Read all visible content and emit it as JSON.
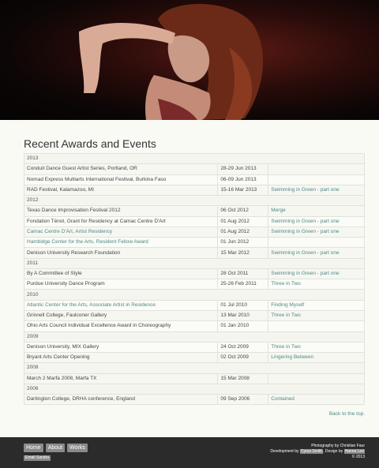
{
  "section_title": "Recent Awards and Events",
  "rows": [
    {
      "type": "year",
      "label": "2013"
    },
    {
      "type": "event",
      "title": "Conduit Dance Guest Artist Series, Portland, OR",
      "title_link": false,
      "date": "28-29 Jun 2013",
      "piece": "",
      "piece_link": false
    },
    {
      "type": "event",
      "title": "Nomad Express Multiarts International Festival, Burkina Faso",
      "title_link": false,
      "date": "06-09 Jun 2013",
      "piece": "",
      "piece_link": false
    },
    {
      "type": "event",
      "title": "RAD Festival, Kalamazoo, MI",
      "title_link": false,
      "date": "15-16 Mar 2013",
      "piece": "Swimming in Green - part one",
      "piece_link": true
    },
    {
      "type": "year",
      "label": "2012"
    },
    {
      "type": "event",
      "title": "Texas Dance Improvisation Festival 2012",
      "title_link": false,
      "date": "06 Oct 2012",
      "piece": "Merge",
      "piece_link": true
    },
    {
      "type": "event",
      "title": "Fondation Ténot, Grant for Residency at Camac Centre D'Art",
      "title_link": false,
      "date": "01 Aug 2012",
      "piece": "Swimming in Green - part one",
      "piece_link": true
    },
    {
      "type": "event",
      "title": "Camac Centre D'Art, Artist Residency",
      "title_link": true,
      "date": "01 Aug 2012",
      "piece": "Swimming in Green - part one",
      "piece_link": true
    },
    {
      "type": "event",
      "title": "Hambidge Center for the Arts, Resident Fellow Award",
      "title_link": true,
      "date": "01 Jun 2012",
      "piece": "",
      "piece_link": false
    },
    {
      "type": "event",
      "title": "Denison University Research Foundation",
      "title_link": false,
      "date": "15 Mar 2012",
      "piece": "Swimming in Green - part one",
      "piece_link": true
    },
    {
      "type": "year",
      "label": "2011"
    },
    {
      "type": "event",
      "title": "By A Committee of Style",
      "title_link": false,
      "date": "28 Oct 2011",
      "piece": "Swimming in Green - part one",
      "piece_link": true
    },
    {
      "type": "event",
      "title": "Purdue University Dance Program",
      "title_link": false,
      "date": "25-26 Feb 2011",
      "piece": "Three in Two",
      "piece_link": true
    },
    {
      "type": "year",
      "label": "2010"
    },
    {
      "type": "event",
      "title": "Atlantic Center for the Arts, Associate Artist in Residence",
      "title_link": true,
      "date": "01 Jul 2010",
      "piece": "Finding Myself",
      "piece_link": true
    },
    {
      "type": "event",
      "title": "Grinnell College, Faulconer Gallery",
      "title_link": false,
      "date": "13 Mar 2010",
      "piece": "Three in Two",
      "piece_link": true
    },
    {
      "type": "event",
      "title": "Ohio Arts Council Individual Excellence Award in Choreography",
      "title_link": false,
      "date": "01 Jan 2010",
      "piece": "",
      "piece_link": false
    },
    {
      "type": "year",
      "label": "2009"
    },
    {
      "type": "event",
      "title": "Denison University, MIX Gallery",
      "title_link": false,
      "date": "24 Oct 2009",
      "piece": "Three in Two",
      "piece_link": true
    },
    {
      "type": "event",
      "title": "Bryant Arts Center Opening",
      "title_link": false,
      "date": "02 Oct 2009",
      "piece": "Lingering Between",
      "piece_link": true
    },
    {
      "type": "year",
      "label": "2008"
    },
    {
      "type": "event",
      "title": "March 2 Marfa 2008, Marfa TX",
      "title_link": false,
      "date": "15 Mar 2008",
      "piece": "",
      "piece_link": false
    },
    {
      "type": "year",
      "label": "2006"
    },
    {
      "type": "event",
      "title": "Dartington College, DRHA conference, England",
      "title_link": false,
      "date": "09 Sep 2006",
      "piece": "Contained",
      "piece_link": true
    }
  ],
  "back_to_top": "Back to the top.",
  "footer": {
    "nav": [
      "Home",
      "About",
      "Works"
    ],
    "email": "Email Sandra",
    "photo_credit": "Photography by Christian Faur",
    "dev_prefix": "Development by ",
    "dev_name": "Cyrus Smith",
    "design_prefix": ", Design by ",
    "design_name": "Hanna Lee",
    "copyright": "© 2013"
  },
  "colors": {
    "link": "#4f8a86",
    "footer_bg": "#2b2b2b",
    "button_bg": "#8a8a8a",
    "page_bg": "#fafaf5"
  }
}
